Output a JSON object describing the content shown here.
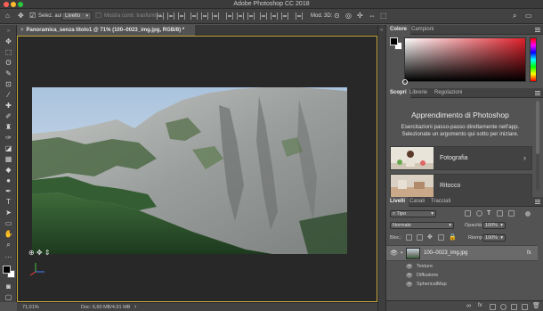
{
  "window": {
    "title": "Adobe Photoshop CC 2018",
    "traffic_lights": [
      "#ff5f57",
      "#febc2e",
      "#28c840"
    ]
  },
  "options_bar": {
    "auto_select_label": "Selez. auto:",
    "auto_select_value": "Livello",
    "transform_controls_label": "Mostra contr. trasformaz.",
    "mode_3d_label": "Mod. 3D:"
  },
  "tools": [
    "move-tool",
    "marquee-tool",
    "lasso-tool",
    "quick-select-tool",
    "crop-tool",
    "eyedropper-tool",
    "healing-tool",
    "brush-tool",
    "clone-stamp-tool",
    "history-brush-tool",
    "eraser-tool",
    "gradient-tool",
    "blur-tool",
    "dodge-tool",
    "pen-tool",
    "type-tool",
    "path-select-tool",
    "shape-tool",
    "hand-tool",
    "zoom-tool",
    "more-tools",
    "color-swatches",
    "quick-mask",
    "screen-mode"
  ],
  "document": {
    "tab_title": "Panoramica_senza titolo1 @ 71% (100–0023_img.jpg, RGB/8) *",
    "zoom": "71,01%",
    "doc_size": "Doc: 6,60 MB/4,91 MB"
  },
  "color_panel": {
    "tabs": [
      "Colore",
      "Campioni"
    ],
    "active_tab": "Colore",
    "hue_color": "#e0202a"
  },
  "learn_panel": {
    "tabs": [
      "Scopri",
      "Librerie",
      "Regolazioni"
    ],
    "active_tab": "Scopri",
    "heading": "Apprendimento di Photoshop",
    "description": "Esercitazioni passo-passo direttamente nell'app. Selezionate un argomento qui sotto per iniziare.",
    "cards": [
      {
        "label": "Fotografia"
      },
      {
        "label": "Ritocco"
      }
    ]
  },
  "layers_panel": {
    "tabs": [
      "Livelli",
      "Canali",
      "Tracciati"
    ],
    "active_tab": "Livelli",
    "filter_kind": "Tipo",
    "blend_mode": "Normale",
    "opacity_label": "Opacità:",
    "opacity_value": "100%",
    "lock_label": "Bloc.:",
    "fill_label": "Riemp.:",
    "fill_value": "100%",
    "layer": {
      "name": "100–0023_img.jpg"
    },
    "effects": [
      "Texture",
      "Diffusione",
      "SphericalMap"
    ]
  }
}
